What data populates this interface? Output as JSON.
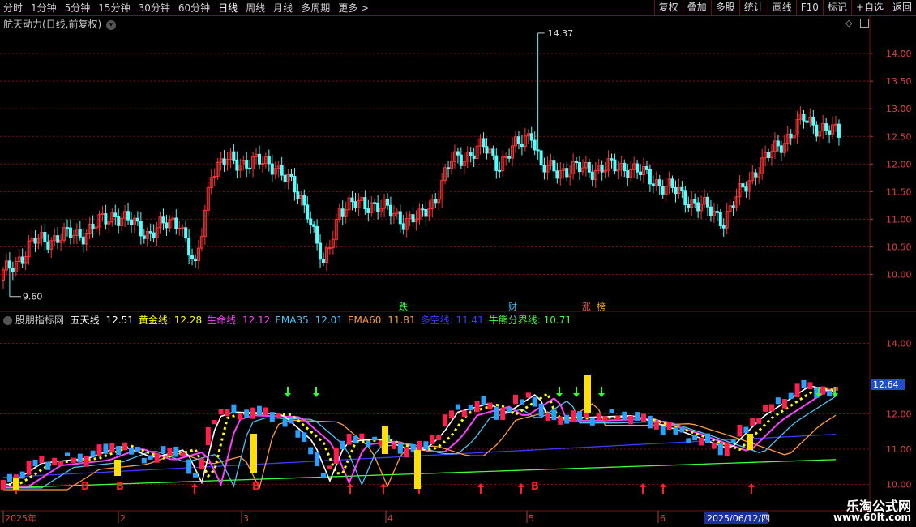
{
  "toolbar": {
    "periods": [
      "分时",
      "1分钟",
      "5分钟",
      "15分钟",
      "30分钟",
      "60分钟",
      "日线",
      "周线",
      "月线",
      "多周期",
      "更多 >"
    ],
    "active_period": "日线",
    "buttons": [
      "复权",
      "叠加",
      "多股",
      "统计",
      "画线",
      "F10",
      "标记",
      "+自选",
      "返回"
    ]
  },
  "main_panel": {
    "title": "航天动力(日线,前复权)",
    "high_label": "14.37",
    "low_label": "9.60",
    "price_ticks": [
      "14.00",
      "13.50",
      "13.00",
      "12.50",
      "12.00",
      "11.50",
      "11.00",
      "10.50",
      "10.00"
    ],
    "event_tags": [
      "跌",
      "财",
      "涨",
      "榜"
    ]
  },
  "indicator_panel": {
    "name": "股朋指标网",
    "legend": [
      {
        "label": "五天线:",
        "value": "12.51",
        "color": "#ffffff"
      },
      {
        "label": "黄金线:",
        "value": "12.28",
        "color": "#ffff00"
      },
      {
        "label": "生命线:",
        "value": "12.12",
        "color": "#ff40ff"
      },
      {
        "label": "EMA35:",
        "value": "12.01",
        "color": "#4fc3f7"
      },
      {
        "label": "EMA60:",
        "value": "11.81",
        "color": "#ff9a40"
      },
      {
        "label": "多空线:",
        "value": "11.41",
        "color": "#3b3bff"
      },
      {
        "label": "牛熊分界线:",
        "value": "10.71",
        "color": "#40ff40"
      }
    ],
    "price_ticks": [
      "14.00",
      "12.00",
      "11.00",
      "10.00"
    ],
    "last_price": "12.64",
    "signal_letter": "B"
  },
  "time_axis": {
    "labels": [
      "2025年",
      "2",
      "3",
      "4",
      "5",
      "6"
    ],
    "cursor_date": "2025/06/12/四"
  },
  "watermark": {
    "name": "乐淘公式网",
    "url": "www.60lt.com"
  },
  "colors": {
    "up": "#ff3232",
    "down": "#54ffff",
    "grid": "#7a1010",
    "text": "#c8c8c8"
  }
}
